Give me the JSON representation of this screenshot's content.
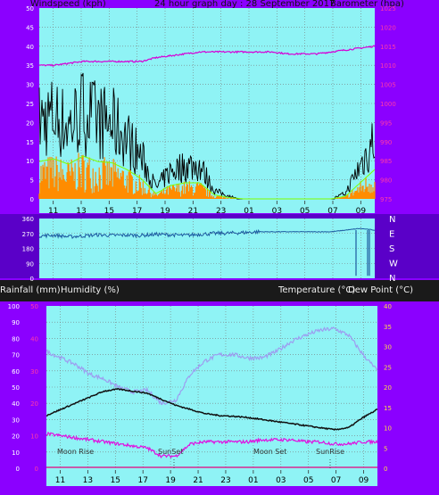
{
  "header": {
    "windspeed_label": "Windspeed (kph)",
    "title": "24 hour graph day : 28 September 2017",
    "barometer_label": "Barometer (hpa)"
  },
  "mid_header": {
    "rain_label": "Rainfall (mm)",
    "humidity_label": "Humidity (%)",
    "temp_label": "Temperature (°C)",
    "dew_label": "Dew Point (°C)"
  },
  "x_ticks": [
    "11",
    "13",
    "15",
    "17",
    "19",
    "21",
    "23",
    "01",
    "03",
    "05",
    "07",
    "09"
  ],
  "colors": {
    "plot_bg": "#8ff3f5",
    "frame": "#8b00ff",
    "wind": "#000000",
    "gust_fill": "#ff8c00",
    "avg_wind": "#7fff00",
    "barometer": "#d600d6",
    "direction": "#1c5aa0",
    "temperature": "#111111",
    "humidity": "#9d9df0",
    "dewpoint": "#e010e0"
  },
  "chart_data": [
    {
      "type": "line",
      "name": "windspeed-barometer",
      "x": [
        "10:00",
        "11:00",
        "12:00",
        "13:00",
        "14:00",
        "15:00",
        "16:00",
        "17:00",
        "18:00",
        "19:00",
        "20:00",
        "21:00",
        "22:00",
        "23:00",
        "00:00",
        "01:00",
        "02:00",
        "03:00",
        "04:00",
        "05:00",
        "06:00",
        "07:00",
        "08:00",
        "09:00"
      ],
      "series": [
        {
          "name": "Windspeed (kph)",
          "axis": "left",
          "values": [
            28,
            30,
            26,
            32,
            28,
            27,
            22,
            15,
            4,
            10,
            12,
            12,
            3,
            1,
            0,
            0,
            0,
            0,
            0,
            0,
            0,
            2,
            12,
            22
          ]
        },
        {
          "name": "Barometer (hpa)",
          "axis": "right",
          "values": [
            1010,
            1010,
            1010.5,
            1011,
            1011,
            1011,
            1011,
            1011,
            1012,
            1012.5,
            1013,
            1013.5,
            1013.5,
            1013.5,
            1013.5,
            1013.5,
            1013.5,
            1013,
            1013,
            1013,
            1013.5,
            1014,
            1014.5,
            1015
          ]
        }
      ],
      "y_left_ticks": [
        "0",
        "5",
        "10",
        "15",
        "20",
        "25",
        "30",
        "35",
        "40",
        "45",
        "50"
      ],
      "y_right_ticks": [
        "975",
        "980",
        "985",
        "990",
        "995",
        "1000",
        "1005",
        "1010",
        "1015",
        "1020",
        "1025"
      ],
      "ylim_left": [
        0,
        50
      ],
      "ylim_right": [
        975,
        1025
      ],
      "grid": true
    },
    {
      "type": "line",
      "name": "wind-direction",
      "x": [
        "10:00",
        "11:00",
        "12:00",
        "13:00",
        "14:00",
        "15:00",
        "16:00",
        "17:00",
        "18:00",
        "19:00",
        "20:00",
        "21:00",
        "22:00",
        "23:00",
        "00:00",
        "01:00",
        "02:00",
        "03:00",
        "04:00",
        "05:00",
        "06:00",
        "07:00",
        "08:00",
        "09:00"
      ],
      "values": [
        255,
        260,
        250,
        255,
        262,
        258,
        260,
        258,
        265,
        262,
        258,
        265,
        270,
        272,
        275,
        280,
        280,
        280,
        280,
        280,
        280,
        290,
        300,
        290
      ],
      "y_ticks": [
        "0",
        "90",
        "180",
        "270",
        "360"
      ],
      "dir_labels": [
        "N",
        "W",
        "S",
        "E",
        "N"
      ],
      "ylim": [
        0,
        360
      ]
    },
    {
      "type": "line",
      "name": "temp-humidity",
      "x": [
        "10:00",
        "11:00",
        "12:00",
        "13:00",
        "14:00",
        "15:00",
        "16:00",
        "17:00",
        "18:00",
        "19:00",
        "20:00",
        "21:00",
        "22:00",
        "23:00",
        "00:00",
        "01:00",
        "02:00",
        "03:00",
        "04:00",
        "05:00",
        "06:00",
        "07:00",
        "08:00",
        "09:00"
      ],
      "series": [
        {
          "name": "Humidity (%)",
          "axis": "left",
          "values": [
            72,
            68,
            64,
            58,
            55,
            50,
            47,
            48,
            40,
            42,
            58,
            66,
            70,
            70,
            68,
            68,
            72,
            78,
            82,
            85,
            86,
            82,
            70,
            60
          ]
        },
        {
          "name": "Temperature (°C)",
          "axis": "right",
          "values": [
            13,
            14.5,
            16,
            17.5,
            19,
            19.5,
            19,
            18.5,
            17,
            15.5,
            14.5,
            13.5,
            13,
            12.8,
            12.5,
            12,
            11.5,
            11,
            10.5,
            10,
            9.5,
            10,
            12.5,
            14.5
          ]
        },
        {
          "name": "Dew Point (°C)",
          "axis": "right",
          "values": [
            8.5,
            8,
            7.5,
            7,
            6.5,
            6,
            5.5,
            5,
            3,
            3,
            6,
            6.5,
            6.5,
            6.5,
            6.5,
            7,
            7,
            7,
            6.5,
            6.5,
            6,
            6,
            6.5,
            6.5
          ]
        }
      ],
      "y_left_ticks": [
        "0",
        "10",
        "20",
        "30",
        "40",
        "50",
        "60",
        "70",
        "80",
        "90",
        "100"
      ],
      "y_right_ticks": [
        "0",
        "5",
        "10",
        "15",
        "20",
        "25",
        "30",
        "35",
        "40"
      ],
      "rain_ticks": [
        "0",
        "10",
        "20",
        "30",
        "40",
        "50"
      ],
      "ylim_left": [
        0,
        100
      ],
      "ylim_right": [
        0,
        40
      ],
      "annotations": [
        "Moon Rise",
        "SunSet",
        "Moon Set",
        "SunRise"
      ]
    }
  ]
}
